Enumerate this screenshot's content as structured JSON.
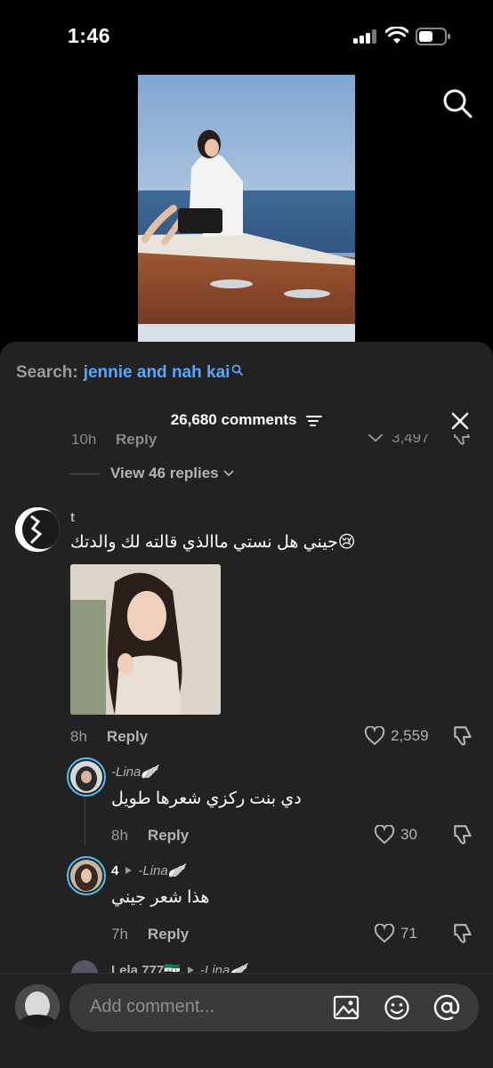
{
  "status": {
    "time": "1:46"
  },
  "search": {
    "label": "Search:",
    "query": "jennie and nah kai"
  },
  "header": {
    "comments_count": "26,680 comments"
  },
  "previous": {
    "time": "10h",
    "reply": "Reply",
    "likes": "3,497",
    "view_replies": "View 46 replies"
  },
  "comment": {
    "username": "t",
    "text": "جيني هل نستي ماالذي قالته لك والدتك😢",
    "time": "8h",
    "reply": "Reply",
    "likes": "2,559"
  },
  "replies": [
    {
      "username": "-Lina🪽",
      "text": "دي بنت ركزي شعرها طويل",
      "time": "8h",
      "reply": "Reply",
      "likes": "30"
    },
    {
      "username": "4",
      "to": "-Lina🪽",
      "text": "هذا شعر جيني",
      "time": "7h",
      "reply": "Reply",
      "likes": "71"
    },
    {
      "username": "Lela 777🇸🇾",
      "to": "-Lina🪽"
    }
  ],
  "composer": {
    "placeholder": "Add comment..."
  },
  "icons": {
    "search": "search-icon",
    "close": "close-icon",
    "filter": "filter-icon",
    "heart": "heart-icon",
    "dislike": "thumbs-down-icon",
    "image": "image-icon",
    "emoji": "emoji-icon",
    "mention": "at-icon"
  },
  "colors": {
    "accent": "#57a6ff",
    "sheet": "#222222",
    "ring": "#4fc3f7"
  }
}
